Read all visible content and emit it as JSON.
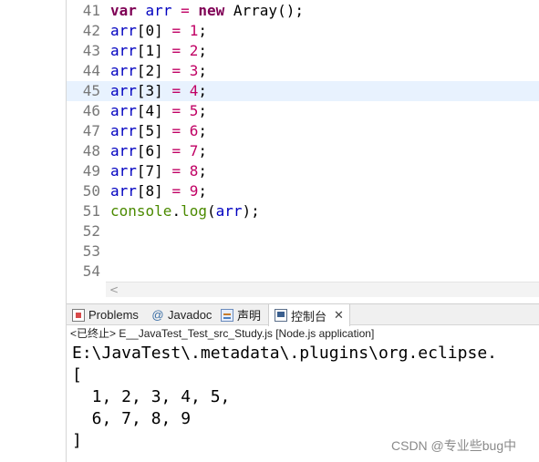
{
  "editor": {
    "lines": [
      {
        "num": "41",
        "tokens": [
          {
            "t": "var",
            "c": "kw"
          },
          {
            "t": " ",
            "c": "plain"
          },
          {
            "t": "arr",
            "c": "var"
          },
          {
            "t": " = ",
            "c": "op"
          },
          {
            "t": "new",
            "c": "kw"
          },
          {
            "t": " Array();",
            "c": "plain"
          }
        ]
      },
      {
        "num": "42",
        "tokens": [
          {
            "t": "arr",
            "c": "var"
          },
          {
            "t": "[0]",
            "c": "plain"
          },
          {
            "t": " = ",
            "c": "op"
          },
          {
            "t": "1",
            "c": "num"
          },
          {
            "t": ";",
            "c": "plain"
          }
        ]
      },
      {
        "num": "43",
        "tokens": [
          {
            "t": "arr",
            "c": "var"
          },
          {
            "t": "[1]",
            "c": "plain"
          },
          {
            "t": " = ",
            "c": "op"
          },
          {
            "t": "2",
            "c": "num"
          },
          {
            "t": ";",
            "c": "plain"
          }
        ]
      },
      {
        "num": "44",
        "tokens": [
          {
            "t": "arr",
            "c": "var"
          },
          {
            "t": "[2]",
            "c": "plain"
          },
          {
            "t": " = ",
            "c": "op"
          },
          {
            "t": "3",
            "c": "num"
          },
          {
            "t": ";",
            "c": "plain"
          }
        ]
      },
      {
        "num": "45",
        "current": true,
        "tokens": [
          {
            "t": "arr",
            "c": "var"
          },
          {
            "t": "[3]",
            "c": "plain"
          },
          {
            "t": " = ",
            "c": "op"
          },
          {
            "t": "4",
            "c": "num"
          },
          {
            "t": ";",
            "c": "plain"
          }
        ]
      },
      {
        "num": "46",
        "tokens": [
          {
            "t": "arr",
            "c": "var"
          },
          {
            "t": "[4]",
            "c": "plain"
          },
          {
            "t": " = ",
            "c": "op"
          },
          {
            "t": "5",
            "c": "num"
          },
          {
            "t": ";",
            "c": "plain"
          }
        ]
      },
      {
        "num": "47",
        "tokens": [
          {
            "t": "arr",
            "c": "var"
          },
          {
            "t": "[5]",
            "c": "plain"
          },
          {
            "t": " = ",
            "c": "op"
          },
          {
            "t": "6",
            "c": "num"
          },
          {
            "t": ";",
            "c": "plain"
          }
        ]
      },
      {
        "num": "48",
        "tokens": [
          {
            "t": "arr",
            "c": "var"
          },
          {
            "t": "[6]",
            "c": "plain"
          },
          {
            "t": " = ",
            "c": "op"
          },
          {
            "t": "7",
            "c": "num"
          },
          {
            "t": ";",
            "c": "plain"
          }
        ]
      },
      {
        "num": "49",
        "tokens": [
          {
            "t": "arr",
            "c": "var"
          },
          {
            "t": "[7]",
            "c": "plain"
          },
          {
            "t": " = ",
            "c": "op"
          },
          {
            "t": "8",
            "c": "num"
          },
          {
            "t": ";",
            "c": "plain"
          }
        ]
      },
      {
        "num": "50",
        "tokens": [
          {
            "t": "arr",
            "c": "var"
          },
          {
            "t": "[8]",
            "c": "plain"
          },
          {
            "t": " = ",
            "c": "op"
          },
          {
            "t": "9",
            "c": "num"
          },
          {
            "t": ";",
            "c": "plain"
          }
        ]
      },
      {
        "num": "51",
        "tokens": [
          {
            "t": "console",
            "c": "fn"
          },
          {
            "t": ".",
            "c": "plain"
          },
          {
            "t": "log",
            "c": "fn"
          },
          {
            "t": "(",
            "c": "plain"
          },
          {
            "t": "arr",
            "c": "var"
          },
          {
            "t": ");",
            "c": "plain"
          }
        ]
      },
      {
        "num": "52",
        "tokens": []
      },
      {
        "num": "53",
        "tokens": []
      },
      {
        "num": "54",
        "tokens": []
      }
    ],
    "scroll_left_arrow": "<"
  },
  "panel": {
    "tabs": [
      {
        "label": "Problems",
        "icon": "problems-icon"
      },
      {
        "label": "Javadoc",
        "icon": "javadoc-icon",
        "glyph": "@"
      },
      {
        "label": "声明",
        "icon": "declaration-icon"
      },
      {
        "label": "控制台",
        "icon": "console-icon",
        "active": true,
        "close": "✕"
      }
    ],
    "console_header": "<已终止> E__JavaTest_Test_src_Study.js [Node.js application]",
    "output_lines": [
      "E:\\JavaTest\\.metadata\\.plugins\\org.eclipse.",
      "[",
      "  1, 2, 3, 4, 5,",
      "  6, 7, 8, 9",
      "]"
    ]
  },
  "watermark": "CSDN @专业些bug中",
  "colors": {
    "keyword": "#7f0055",
    "variable": "#0000c0",
    "number": "#c00064",
    "function": "#4b8a00",
    "current_line": "#e8f2fe"
  }
}
